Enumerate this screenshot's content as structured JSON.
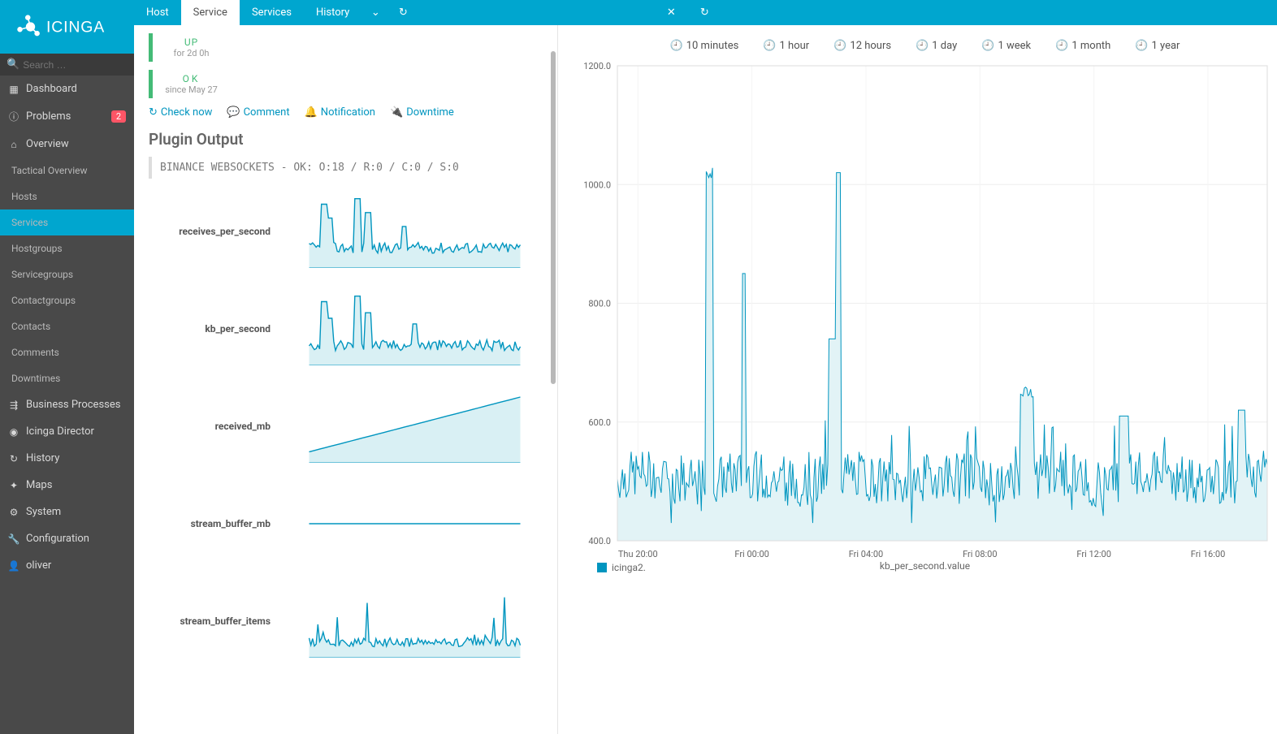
{
  "brand": "ICINGA",
  "search": {
    "placeholder": "Search …"
  },
  "sidebar": {
    "items": [
      {
        "icon": "dashboard",
        "label": "Dashboard"
      },
      {
        "icon": "alert",
        "label": "Problems",
        "badge": "2"
      },
      {
        "icon": "home",
        "label": "Overview"
      }
    ],
    "overview_sub": [
      "Tactical Overview",
      "Hosts",
      "Services",
      "Hostgroups",
      "Servicegroups",
      "Contactgroups",
      "Contacts",
      "Comments",
      "Downtimes"
    ],
    "items2": [
      {
        "icon": "sitemap",
        "label": "Business Processes"
      },
      {
        "icon": "cube",
        "label": "Icinga Director"
      },
      {
        "icon": "history",
        "label": "History"
      },
      {
        "icon": "map",
        "label": "Maps"
      },
      {
        "icon": "cogs",
        "label": "System"
      },
      {
        "icon": "wrench",
        "label": "Configuration"
      },
      {
        "icon": "user",
        "label": "oliver"
      }
    ]
  },
  "tabs": [
    "Host",
    "Service",
    "Services",
    "History"
  ],
  "status": {
    "host_state": "UP",
    "host_since": "for 2d 0h",
    "svc_state": "OK",
    "svc_since": "since May 27"
  },
  "actions": {
    "check": "Check now",
    "comment": "Comment",
    "notify": "Notification",
    "downtime": "Downtime"
  },
  "plugin": {
    "heading": "Plugin Output",
    "text": "BINANCE WEBSOCKETS - OK: O:18 / R:0 / C:0 / S:0"
  },
  "metrics": [
    "receives_per_second",
    "kb_per_second",
    "received_mb",
    "stream_buffer_mb",
    "stream_buffer_items"
  ],
  "ranges": [
    "10 minutes",
    "1 hour",
    "12 hours",
    "1 day",
    "1 week",
    "1 month",
    "1 year"
  ],
  "legend": "icinga2.",
  "chart_bottom_label": "kb_per_second.value",
  "chart_data": {
    "type": "line",
    "title": "kb_per_second.value",
    "ylabel": "",
    "xlabel": "",
    "ylim": [
      400,
      1200
    ],
    "y_ticks": [
      400,
      600,
      800,
      1000,
      1200
    ],
    "x_ticks": [
      "Thu 20:00",
      "Fri 00:00",
      "Fri 04:00",
      "Fri 08:00",
      "Fri 12:00",
      "Fri 16:00"
    ],
    "series": [
      {
        "name": "icinga2.",
        "approx": "noisy kb/s, baseline ~500-550, two tall spikes ~1030 near Thu 20:00 and Fri 00:00, occasional bumps to ~650, dips to ~440"
      }
    ]
  }
}
